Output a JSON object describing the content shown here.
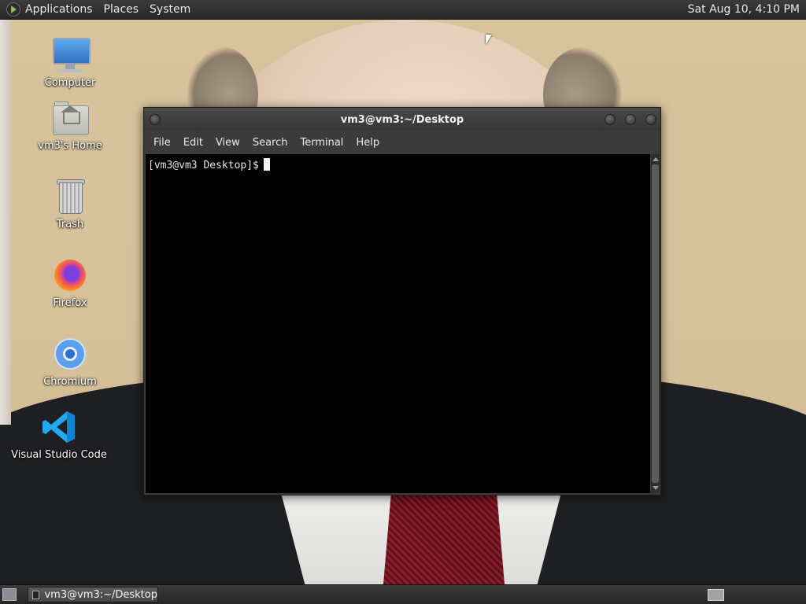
{
  "top_panel": {
    "menus": [
      "Applications",
      "Places",
      "System"
    ],
    "clock": "Sat Aug 10,  4:10 PM"
  },
  "desktop_icons": [
    {
      "label": "Computer",
      "icon": "computer-icon"
    },
    {
      "label": "vm3's Home",
      "icon": "home-folder-icon"
    },
    {
      "label": "Trash",
      "icon": "trash-icon"
    },
    {
      "label": "Firefox",
      "icon": "firefox-icon"
    },
    {
      "label": "Chromium",
      "icon": "chromium-icon"
    },
    {
      "label": "Visual Studio Code",
      "icon": "vscode-icon"
    }
  ],
  "terminal": {
    "title": "vm3@vm3:~/Desktop",
    "menu": [
      "File",
      "Edit",
      "View",
      "Search",
      "Terminal",
      "Help"
    ],
    "prompt": "[vm3@vm3 Desktop]$"
  },
  "taskbar": {
    "task_label": "vm3@vm3:~/Desktop"
  },
  "colors": {
    "panel": "#2e2e2e",
    "terminal_bg": "#000000",
    "vscode_blue": "#23a9f2"
  }
}
